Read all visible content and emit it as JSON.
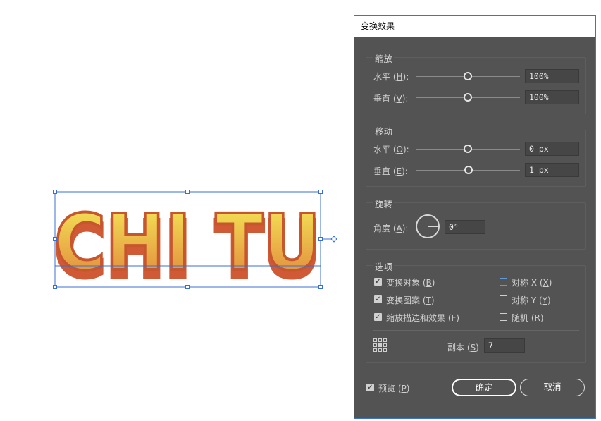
{
  "canvas": {
    "art_text": "CHI TU",
    "colors": {
      "fill_top": "#f5ec58",
      "fill_bottom": "#e0813a",
      "outline": "#c7552e",
      "shadow": "#cf5a35",
      "selection": "#3a6fd0"
    }
  },
  "dialog": {
    "title": "变换效果",
    "scale": {
      "title": "缩放",
      "h_label": "水平",
      "h_key": "H",
      "h_value": "100%",
      "h_level": 0.5,
      "v_label": "垂直",
      "v_key": "V",
      "v_value": "100%",
      "v_level": 0.5
    },
    "move": {
      "title": "移动",
      "h_label": "水平",
      "h_key": "O",
      "h_value": "0 px",
      "h_level": 0.5,
      "v_label": "垂直",
      "v_key": "E",
      "v_value": "1 px",
      "v_level": 0.51
    },
    "rotate": {
      "title": "旋转",
      "angle_label": "角度",
      "angle_key": "A",
      "angle_value": "0°"
    },
    "options": {
      "title": "选项",
      "transform_objects": {
        "label": "变换对象",
        "key": "B",
        "checked": true
      },
      "transform_patterns": {
        "label": "变换图案",
        "key": "T",
        "checked": true
      },
      "scale_strokes": {
        "label": "缩放描边和效果",
        "key": "F",
        "checked": true
      },
      "reflect_x": {
        "label": "对称 X",
        "key": "X",
        "checked": false
      },
      "reflect_y": {
        "label": "对称 Y",
        "key": "Y",
        "checked": false
      },
      "random": {
        "label": "随机",
        "key": "R",
        "checked": false
      },
      "copies_label": "副本",
      "copies_key": "S",
      "copies_value": "7",
      "reference_point_icon": "reference-point-grid"
    },
    "preview": {
      "label": "预览",
      "key": "P",
      "checked": true
    },
    "ok_label": "确定",
    "cancel_label": "取消"
  }
}
